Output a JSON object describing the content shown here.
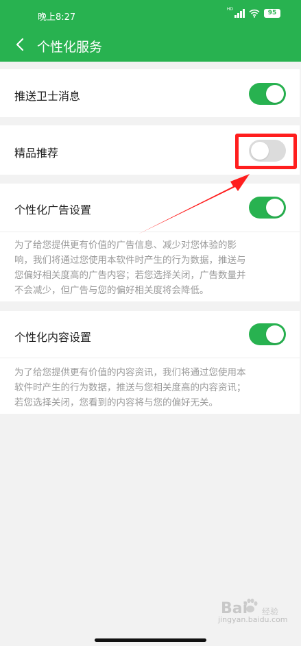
{
  "status_bar": {
    "time": "晚上8:27",
    "battery": "95"
  },
  "header": {
    "title": "个性化服务"
  },
  "settings": {
    "push_guard": {
      "label": "推送卫士消息",
      "enabled": true
    },
    "recommend": {
      "label": "精品推荐",
      "enabled": false
    },
    "ad": {
      "label": "个性化广告设置",
      "enabled": true,
      "desc_lines": [
        "为了给您提供更有价值的广告信息、减少对您体验的影",
        "响，我们将通过您使用本软件时产生的行为数据，推送与",
        "您偏好相关度高的广告内容；若您选择关闭，广告数量并",
        "不会减少，但广告与您的偏好相关度将会降低。"
      ]
    },
    "content": {
      "label": "个性化内容设置",
      "enabled": true,
      "desc_lines": [
        "为了给您提供更有价值的内容资讯，我们将通过您使用本",
        "软件时产生的行为数据，推送与您相关度高的内容资讯；",
        "若您选择关闭，您看到的内容将与您的偏好无关。"
      ]
    }
  },
  "watermark": {
    "brand": "Bai",
    "brand_suffix": "经验",
    "url": "jingyan.baidu.com"
  },
  "colors": {
    "accent": "#28b250",
    "annotation": "#ff1e1e"
  }
}
